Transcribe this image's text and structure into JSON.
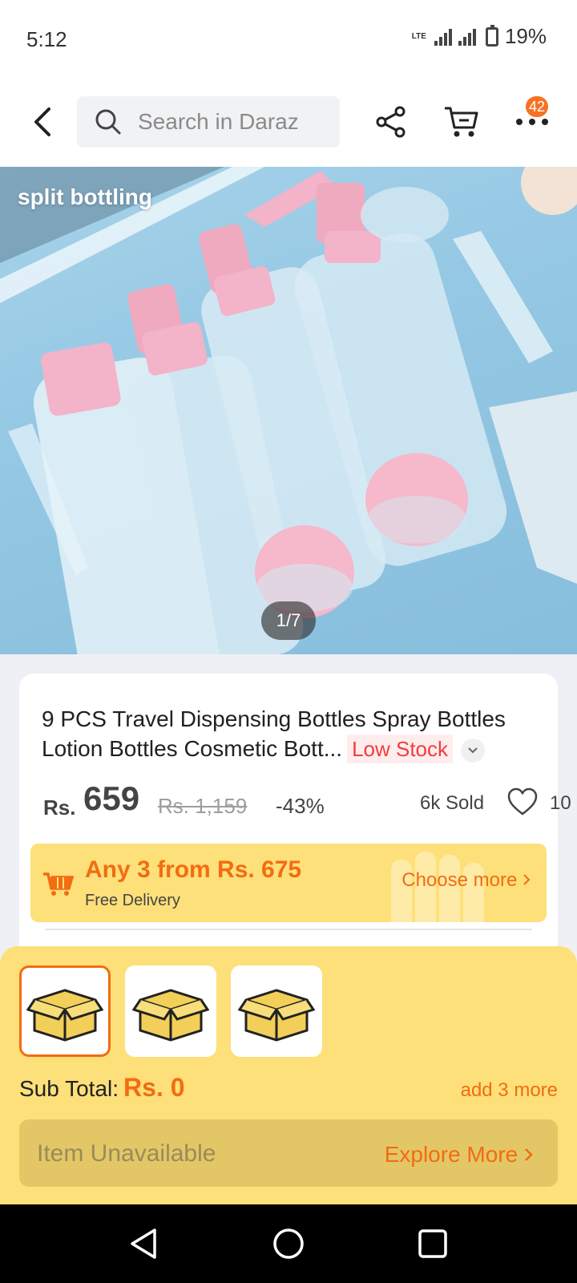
{
  "status_bar": {
    "time": "5:12",
    "network": "LTE",
    "battery": "19%"
  },
  "header": {
    "search_placeholder": "Search in Daraz",
    "cart_badge": "42",
    "icons": [
      "back-arrow-icon",
      "search-icon",
      "share-icon",
      "cart-icon",
      "more-icon"
    ]
  },
  "gallery": {
    "caption": "split bottling",
    "counter": "1/7"
  },
  "product": {
    "title": "9 PCS Travel Dispensing Bottles Spray Bottles Lotion Bottles Cosmetic Bott...",
    "stock_badge": "Low Stock",
    "currency": "Rs.",
    "price": "659",
    "original_price": "Rs. 1,159",
    "discount": "-43%",
    "sold": "6k Sold",
    "wishlist_count": "10"
  },
  "promo": {
    "title": "Any 3 from Rs. 675",
    "subtitle": "Free Delivery",
    "link": "Choose more"
  },
  "bundle_sheet": {
    "slots": 3,
    "selected_slot": 0,
    "subtotal_label": "Sub Total:",
    "subtotal_value": "Rs. 0",
    "add_more": "add 3 more",
    "unavailable": "Item Unavailable",
    "explore": "Explore More"
  },
  "colors": {
    "accent": "#f36c12",
    "promo_bg": "#fde07a",
    "badge": "#f57224",
    "low_stock": "#f23c3c"
  }
}
